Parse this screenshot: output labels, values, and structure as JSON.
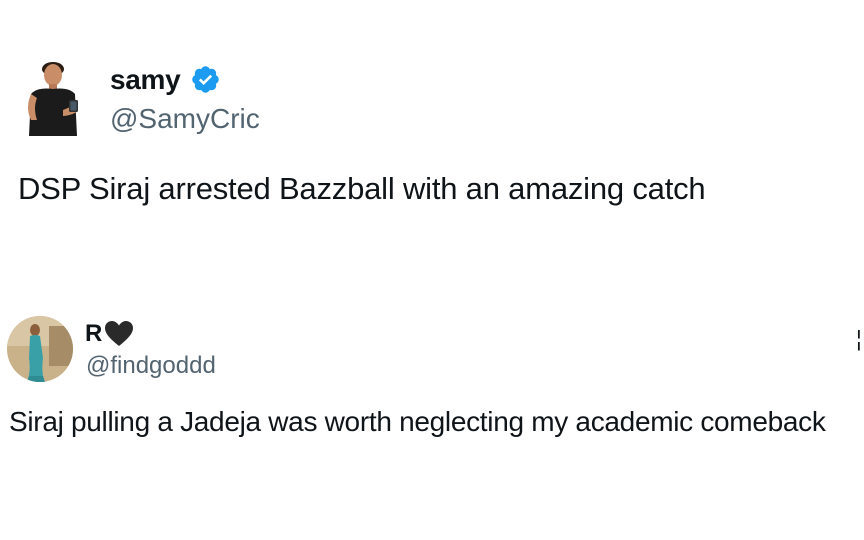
{
  "tweet1": {
    "display_name": "samy",
    "handle": "@SamyCric",
    "text": "DSP Siraj arrested Bazzball with an amazing catch",
    "verified_icon": "verified-badge-icon",
    "verified_color": "#1d9bf0"
  },
  "tweet2": {
    "display_name": "R",
    "name_icon": "black-heart-icon",
    "handle": "@findgoddd",
    "text": "Siraj pulling a Jadeja was worth neglecting my academic comeback"
  },
  "edge_glyph": "¦"
}
